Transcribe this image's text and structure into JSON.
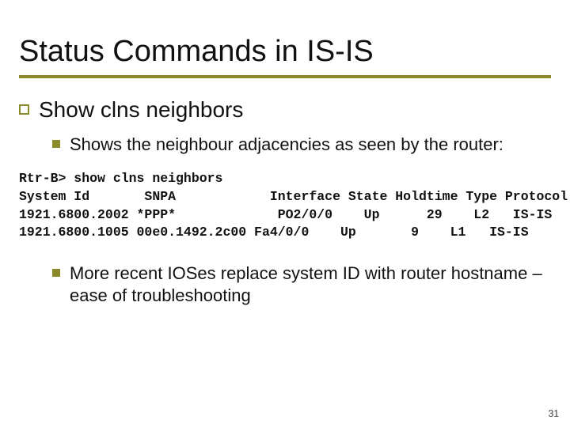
{
  "title": "Status Commands in IS-IS",
  "point1": "Show clns neighbors",
  "sub1": "Shows the neighbour adjacencies as seen by the router:",
  "code": "Rtr-B> show clns neighbors\nSystem Id       SNPA            Interface State Holdtime Type Protocol\n1921.6800.2002 *PPP*             PO2/0/0    Up      29    L2   IS-IS\n1921.6800.1005 00e0.1492.2c00 Fa4/0/0    Up       9    L1   IS-IS",
  "sub2": "More recent IOSes replace system ID with router hostname – ease of troubleshooting",
  "page": "31"
}
